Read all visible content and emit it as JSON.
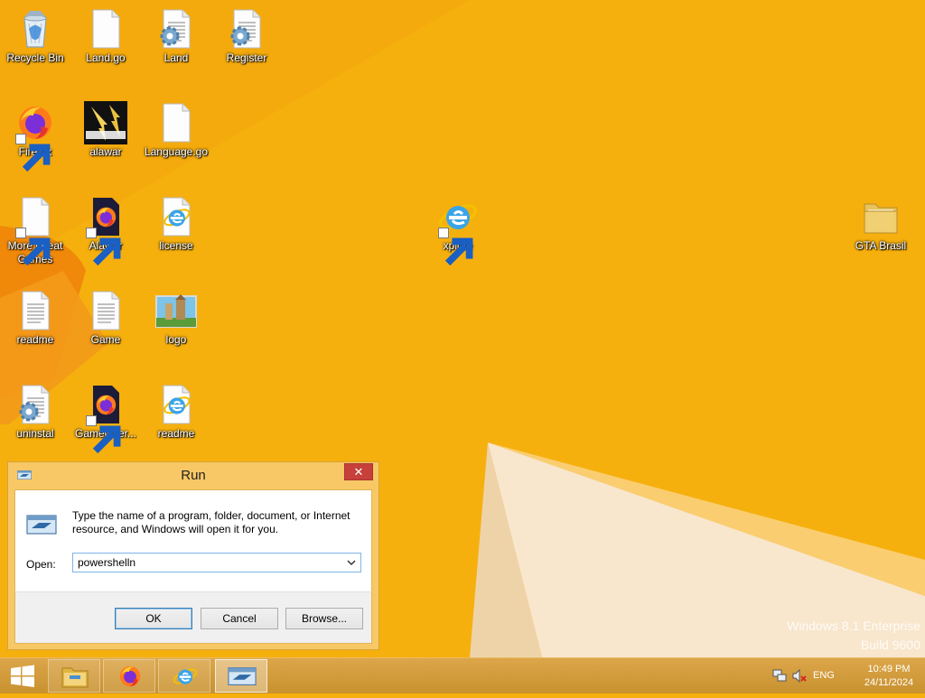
{
  "desktop": {
    "icons": [
      {
        "label": "Recycle Bin",
        "icon": "recycle-bin-icon"
      },
      {
        "label": "Land.go",
        "icon": "blank-file-icon"
      },
      {
        "label": "Land",
        "icon": "config-file-icon"
      },
      {
        "label": "Register",
        "icon": "config-file-icon"
      },
      {
        "label": "Firefox",
        "icon": "firefox-icon"
      },
      {
        "label": "alawar",
        "icon": "alawar-logo-icon"
      },
      {
        "label": "Language.go",
        "icon": "blank-file-icon"
      },
      {
        "label": "More Great Games",
        "icon": "blank-file-icon"
      },
      {
        "label": "Alawar",
        "icon": "firefox-document-icon"
      },
      {
        "label": "license",
        "icon": "ie-document-icon"
      },
      {
        "label": "xplore",
        "icon": "internet-explorer-icon"
      },
      {
        "label": "GTA Brasil",
        "icon": "folder-icon"
      },
      {
        "label": "readme",
        "icon": "text-file-icon"
      },
      {
        "label": "Game",
        "icon": "text-file-icon"
      },
      {
        "label": "logo",
        "icon": "image-file-icon"
      },
      {
        "label": "uninstal",
        "icon": "config-file-icon"
      },
      {
        "label": "GameOver...",
        "icon": "firefox-document-icon"
      },
      {
        "label": "readme",
        "icon": "ie-document-icon"
      }
    ],
    "watermark": {
      "line1": "Windows 8.1 Enterprise",
      "line2": "Build 9600"
    }
  },
  "run_dialog": {
    "title": "Run",
    "close_label": "✕",
    "description": "Type the name of a program, folder, document, or Internet resource, and Windows will open it for you.",
    "open_label": "Open:",
    "open_value": "powershelln",
    "ok_label": "OK",
    "cancel_label": "Cancel",
    "browse_label": "Browse..."
  },
  "taskbar": {
    "items": [
      "file-explorer-icon",
      "firefox-icon",
      "internet-explorer-icon",
      "run-dialog-icon"
    ],
    "language": "ENG",
    "time": "10:49 PM",
    "date": "24/11/2024"
  },
  "colors": {
    "wallpaper": "#f6b00e",
    "dialog_frame": "#f7c865",
    "close_button": "#c7413a"
  }
}
